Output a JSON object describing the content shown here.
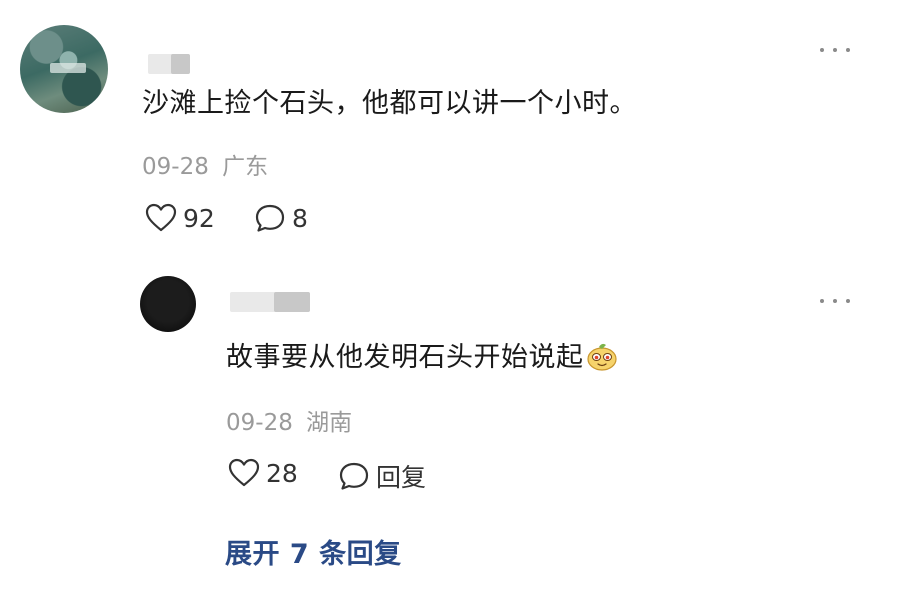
{
  "comment": {
    "text": "沙滩上捡个石头，他都可以讲一个小时。",
    "date": "09-28",
    "location": "广东",
    "likes": "92",
    "replies": "8"
  },
  "reply": {
    "text": "故事要从他发明石头开始说起",
    "date": "09-28",
    "location": "湖南",
    "likes": "28",
    "reply_label": "回复"
  },
  "expand_label": "展开 7 条回复",
  "icons": {
    "more": "more-dots-icon",
    "like": "heart-outline-icon",
    "comment": "comment-bubble-icon",
    "emoji": "smirk-face-emoji"
  },
  "colors": {
    "text": "#1a1a1a",
    "meta": "#9a9a9a",
    "link": "#2a4a86"
  }
}
